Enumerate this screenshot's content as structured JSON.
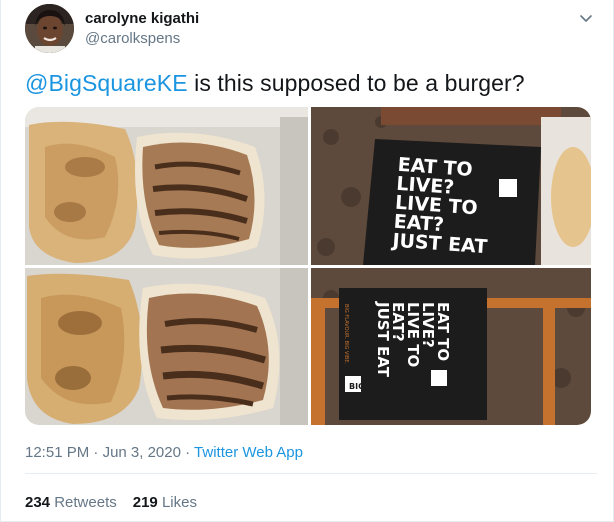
{
  "author": {
    "display_name": "carolyne kigathi",
    "handle": "@carolkspens",
    "avatar_icon": "profile-photo"
  },
  "tweet": {
    "mention": "@BigSquareKE",
    "text": " is this supposed to be a burger?"
  },
  "media": {
    "box_lines": [
      "EAT TO",
      "LIVE?",
      "LIVE TO",
      "EAT?",
      "JUST EAT"
    ],
    "box_logo": "BIG",
    "box_side_text": "BIG FLAVOUR. BIG VIBE."
  },
  "meta": {
    "time": "12:51 PM",
    "separator": " · ",
    "date": "Jun 3, 2020",
    "app": "Twitter Web App"
  },
  "stats": {
    "retweets_count": "234",
    "retweets_label": "Retweets",
    "likes_count": "219",
    "likes_label": "Likes"
  },
  "colors": {
    "link": "#1b95e0",
    "secondary_text": "#657786",
    "primary_text": "#14171a"
  }
}
